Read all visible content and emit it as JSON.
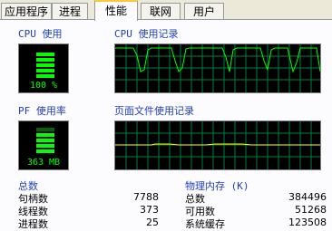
{
  "tabs": [
    "应用程序",
    "进程",
    "性能",
    "联网",
    "用户"
  ],
  "active_tab": "性能",
  "cpu": {
    "label": "CPU 使用",
    "value": "100 %"
  },
  "cpu_history": {
    "label": "CPU 使用记录"
  },
  "pf": {
    "label": "PF 使用率",
    "value": "363 MB"
  },
  "pf_history": {
    "label": "页面文件使用记录"
  },
  "totals": {
    "title": "总数",
    "rows": [
      {
        "label": "句柄数",
        "value": "7788"
      },
      {
        "label": "线程数",
        "value": "373"
      },
      {
        "label": "进程数",
        "value": "25"
      }
    ]
  },
  "physical_memory": {
    "title": "物理内存 (K)",
    "rows": [
      {
        "label": "总数",
        "value": "384496"
      },
      {
        "label": "可用数",
        "value": "51268"
      },
      {
        "label": "系统缓存",
        "value": "123508"
      }
    ]
  },
  "colors": {
    "graph_line": "#00ff00",
    "pf_line": "#ffff00",
    "grid": "#008040",
    "label": "#1f3fbf"
  }
}
